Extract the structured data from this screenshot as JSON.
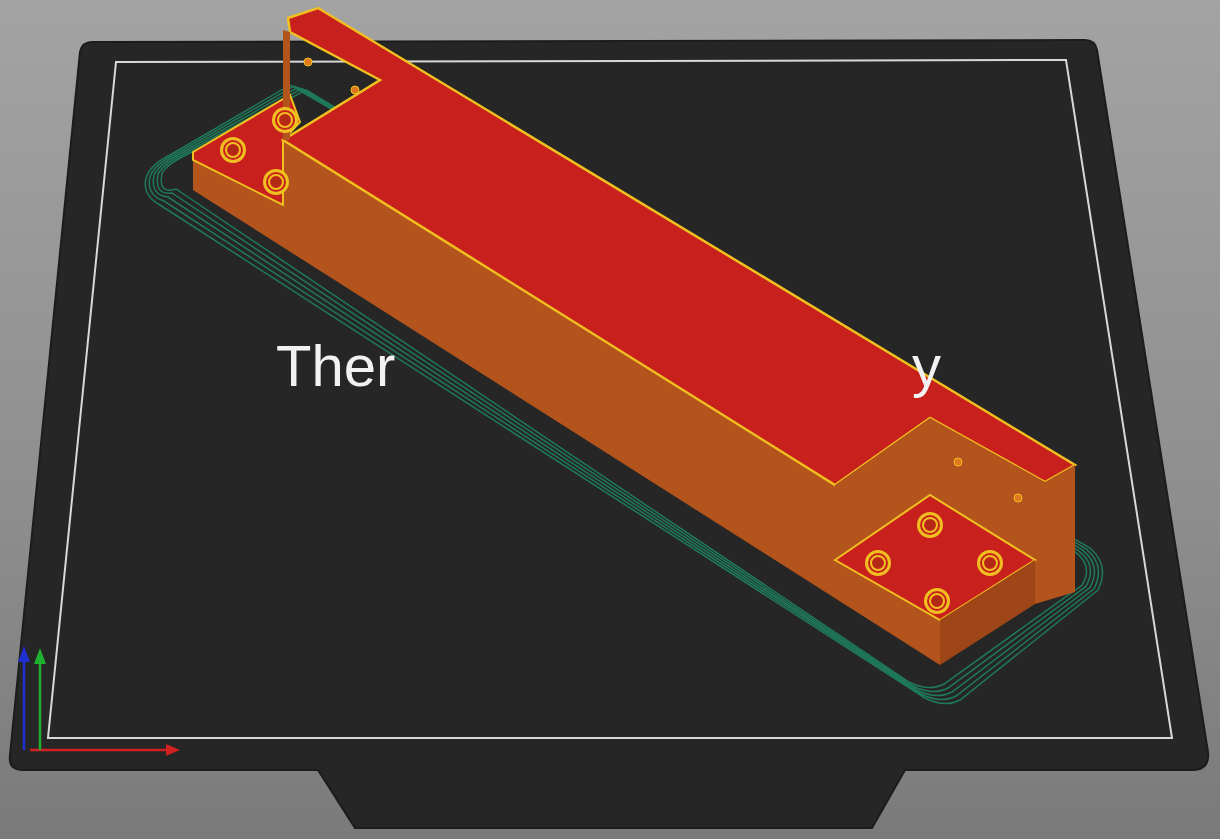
{
  "viewport": {
    "bed_label_fragments": [
      "Ther",
      "y"
    ]
  }
}
